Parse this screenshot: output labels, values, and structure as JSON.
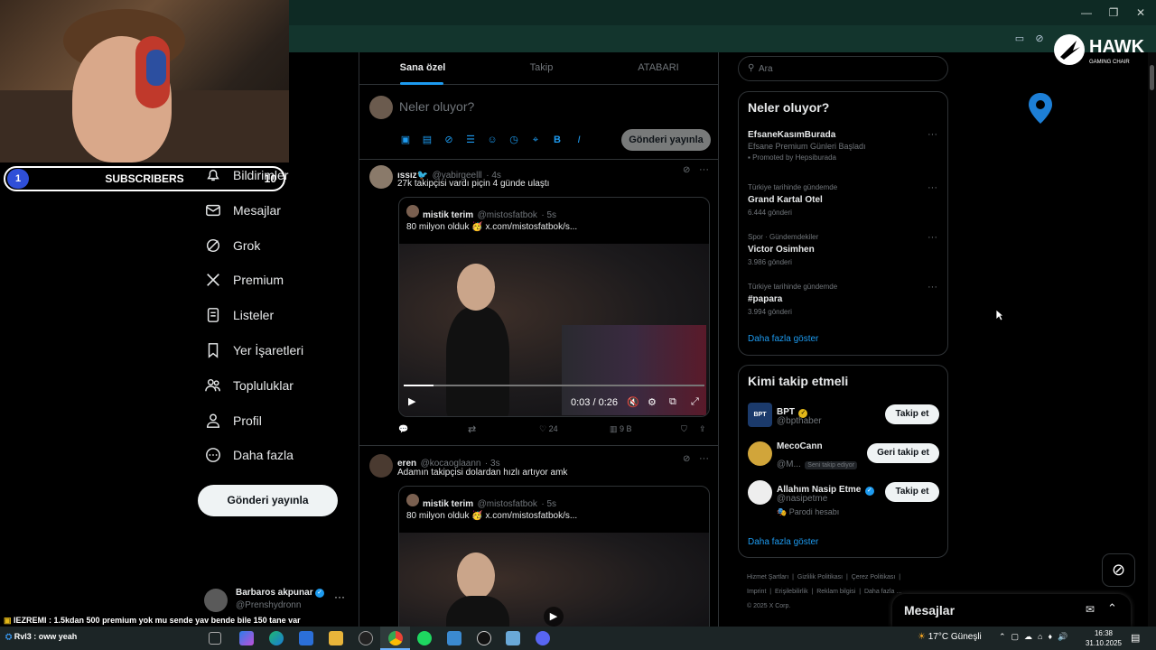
{
  "webcam": {
    "subscribers": {
      "count": "1",
      "label": "SUBSCRIBERS",
      "goal": "10"
    }
  },
  "brand": {
    "logo": "HAWK",
    "tagline": "GAMING CHAIR"
  },
  "nav": {
    "items": [
      {
        "label": "Bildirimler",
        "icon": "bell-icon"
      },
      {
        "label": "Mesajlar",
        "icon": "mail-icon"
      },
      {
        "label": "Grok",
        "icon": "grok-icon"
      },
      {
        "label": "Premium",
        "icon": "x-logo-icon"
      },
      {
        "label": "Listeler",
        "icon": "list-icon"
      },
      {
        "label": "Yer İşaretleri",
        "icon": "bookmark-icon"
      },
      {
        "label": "Topluluklar",
        "icon": "people-icon"
      },
      {
        "label": "Profil",
        "icon": "person-icon"
      },
      {
        "label": "Daha fazla",
        "icon": "more-circle-icon"
      }
    ],
    "post_button": "Gönderi yayınla",
    "account": {
      "name": "Barbaros akpunar",
      "handle": "@Prenshydronn"
    }
  },
  "timeline": {
    "tabs": [
      "Sana özel",
      "Takip",
      "ATABARI"
    ],
    "active_tab": 0,
    "composer": {
      "placeholder": "Neler oluyor?",
      "button": "Gönderi yayınla"
    },
    "tweets": [
      {
        "name": "ıssız🐦",
        "handle": "@yabirgeelll",
        "time": "· 4s",
        "text": "27k takipçisi vardı piçin 4 günde ulaştı",
        "quote": {
          "name": "mistik terim",
          "handle": "@mistosfatbok",
          "time": "· 5s",
          "text": "80 milyon olduk 🥳 x.com/mistosfatbok/s..."
        },
        "video": {
          "time": "0:03 / 0:26",
          "progress": 0.1
        },
        "actions": {
          "likes": "24",
          "views": "9 B"
        }
      },
      {
        "name": "eren",
        "handle": "@kocaoglaann",
        "time": "· 3s",
        "text": "Adamın takipçisi dolardan hızlı artıyor amk",
        "quote": {
          "name": "mistik terim",
          "handle": "@mistosfatbok",
          "time": "· 5s",
          "text": "80 milyon olduk 🥳 x.com/mistosfatbok/s..."
        }
      }
    ]
  },
  "sidebar": {
    "search_placeholder": "Ara",
    "trends_title": "Neler oluyor?",
    "trends": [
      {
        "name": "EfsaneKasımBurada",
        "sub": "Efsane Premium Günleri Başladı",
        "meta": "Promoted by Hepsiburada"
      },
      {
        "meta_top": "Türkiye tarihinde gündemde",
        "name": "Grand Kartal Otel",
        "meta": "6.444 gönderi"
      },
      {
        "meta_top": "Spor · Gündemdekiler",
        "name": "Victor Osimhen",
        "meta": "3.986 gönderi"
      },
      {
        "meta_top": "Türkiye tarihinde gündemde",
        "name": "#papara",
        "meta": "3.994 gönderi"
      }
    ],
    "show_more": "Daha fazla göster",
    "who_title": "Kimi takip etmeli",
    "who": [
      {
        "name": "BPT",
        "handle": "@bpthaber",
        "button": "Takip et",
        "verified": true
      },
      {
        "name": "MecoCann",
        "handle": "@M...",
        "note": "Seni takip ediyor",
        "button": "Geri takip et"
      },
      {
        "name": "Allahım Nasip Etme",
        "handle": "@nasipetme",
        "note": "🎭 Parodi hesabı",
        "button": "Takip et",
        "verified": true
      }
    ],
    "who_more": "Daha fazla göster",
    "footer": [
      "Hizmet Şartları",
      "Gizlilik Politikası",
      "Çerez Politikası",
      "Imprint",
      "Erişilebilirlik",
      "Reklam bilgisi",
      "Daha fazla ...",
      "© 2025 X Corp."
    ]
  },
  "messages_drawer": {
    "title": "Mesajlar"
  },
  "chat": {
    "line1": "IEZREMI : 1.5kdan 500 premium yok mu sende yav bende bile 150 tane var",
    "line2": "Rvl3 : oww yeah"
  },
  "taskbar": {
    "weather": "17°C Güneşli",
    "time": "16:38",
    "date": "31.10.2025"
  },
  "colors": {
    "accent": "#1d9bf0",
    "bg": "#000000",
    "border": "#2f3336",
    "browser": "#13352d"
  }
}
